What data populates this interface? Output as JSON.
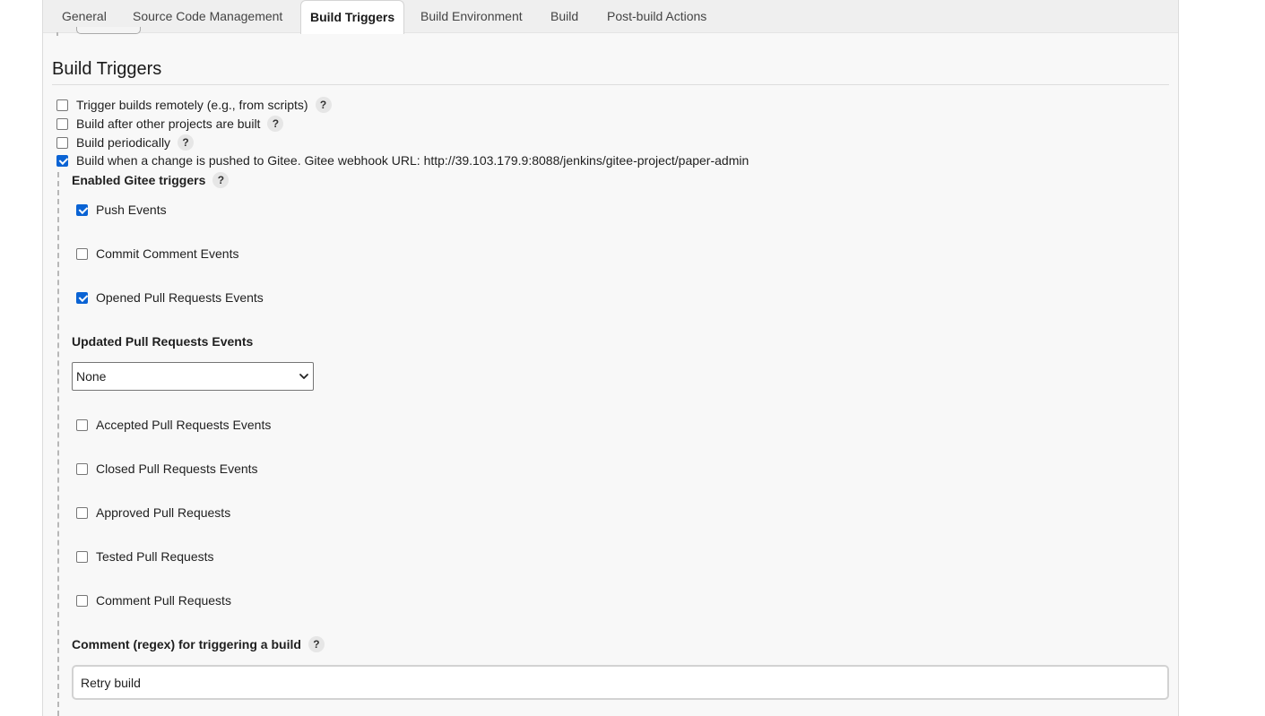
{
  "tabs": [
    {
      "label": "General"
    },
    {
      "label": "Source Code Management"
    },
    {
      "label": "Build Triggers",
      "active": true
    },
    {
      "label": "Build Environment"
    },
    {
      "label": "Build"
    },
    {
      "label": "Post-build Actions"
    }
  ],
  "section": {
    "title": "Build Triggers"
  },
  "triggers": [
    {
      "label": "Trigger builds remotely (e.g., from scripts)",
      "checked": false,
      "help": "?"
    },
    {
      "label": "Build after other projects are built",
      "checked": false,
      "help": "?"
    },
    {
      "label": "Build periodically",
      "checked": false,
      "help": "?"
    },
    {
      "label": "Build when a change is pushed to Gitee. Gitee webhook URL: http://39.103.179.9:8088/jenkins/gitee-project/paper-admin",
      "checked": true
    }
  ],
  "gitee": {
    "enabled_label": "Enabled Gitee triggers",
    "enabled_help": "?",
    "events": [
      {
        "label": "Push Events",
        "checked": true
      },
      {
        "label": "Commit Comment Events",
        "checked": false
      },
      {
        "label": "Opened Pull Requests Events",
        "checked": true
      }
    ],
    "updated_pr_label": "Updated Pull Requests Events",
    "updated_pr_value": "None",
    "pr_events": [
      {
        "label": "Accepted Pull Requests Events",
        "checked": false
      },
      {
        "label": "Closed Pull Requests Events",
        "checked": false
      },
      {
        "label": "Approved Pull Requests",
        "checked": false
      },
      {
        "label": "Tested Pull Requests",
        "checked": false
      },
      {
        "label": "Comment Pull Requests",
        "checked": false
      }
    ],
    "comment_regex_label": "Comment (regex) for triggering a build",
    "comment_regex_help": "?",
    "comment_regex_value": "Retry build"
  },
  "icons": {
    "checkbox_checked_color": "#0a63d4",
    "dropdown_chevron": "chevron-down-icon",
    "help": "question-mark-icon"
  }
}
